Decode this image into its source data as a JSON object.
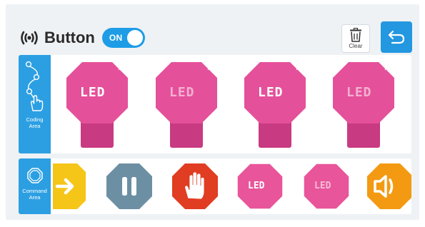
{
  "header": {
    "title": "Button",
    "toggle_label": "ON",
    "clear_label": "Clear"
  },
  "coding_area": {
    "label": "Coding\nArea",
    "blocks": [
      {
        "type": "led",
        "text": "LED",
        "text_bright": true
      },
      {
        "type": "led",
        "text": "LED",
        "text_bright": false
      },
      {
        "type": "led",
        "text": "LED",
        "text_bright": true
      },
      {
        "type": "led",
        "text": "LED",
        "text_bright": false
      }
    ]
  },
  "command_area": {
    "label": "Command\nArea",
    "blocks": [
      {
        "icon": "arrow-right-icon",
        "color": "#f5c518"
      },
      {
        "icon": "pause-icon",
        "color": "#6c8fa3"
      },
      {
        "icon": "stop-hand-icon",
        "color": "#e03d22"
      },
      {
        "icon": "led-icon",
        "text": "LED",
        "color": "#e8559a"
      },
      {
        "icon": "led-icon",
        "text": "LED",
        "color": "#e8559a"
      },
      {
        "icon": "speaker-icon",
        "color": "#f39a12"
      }
    ]
  },
  "colors": {
    "accent": "#2397e0",
    "led_block": "#e5509a",
    "led_block_dark": "#c83a81"
  }
}
